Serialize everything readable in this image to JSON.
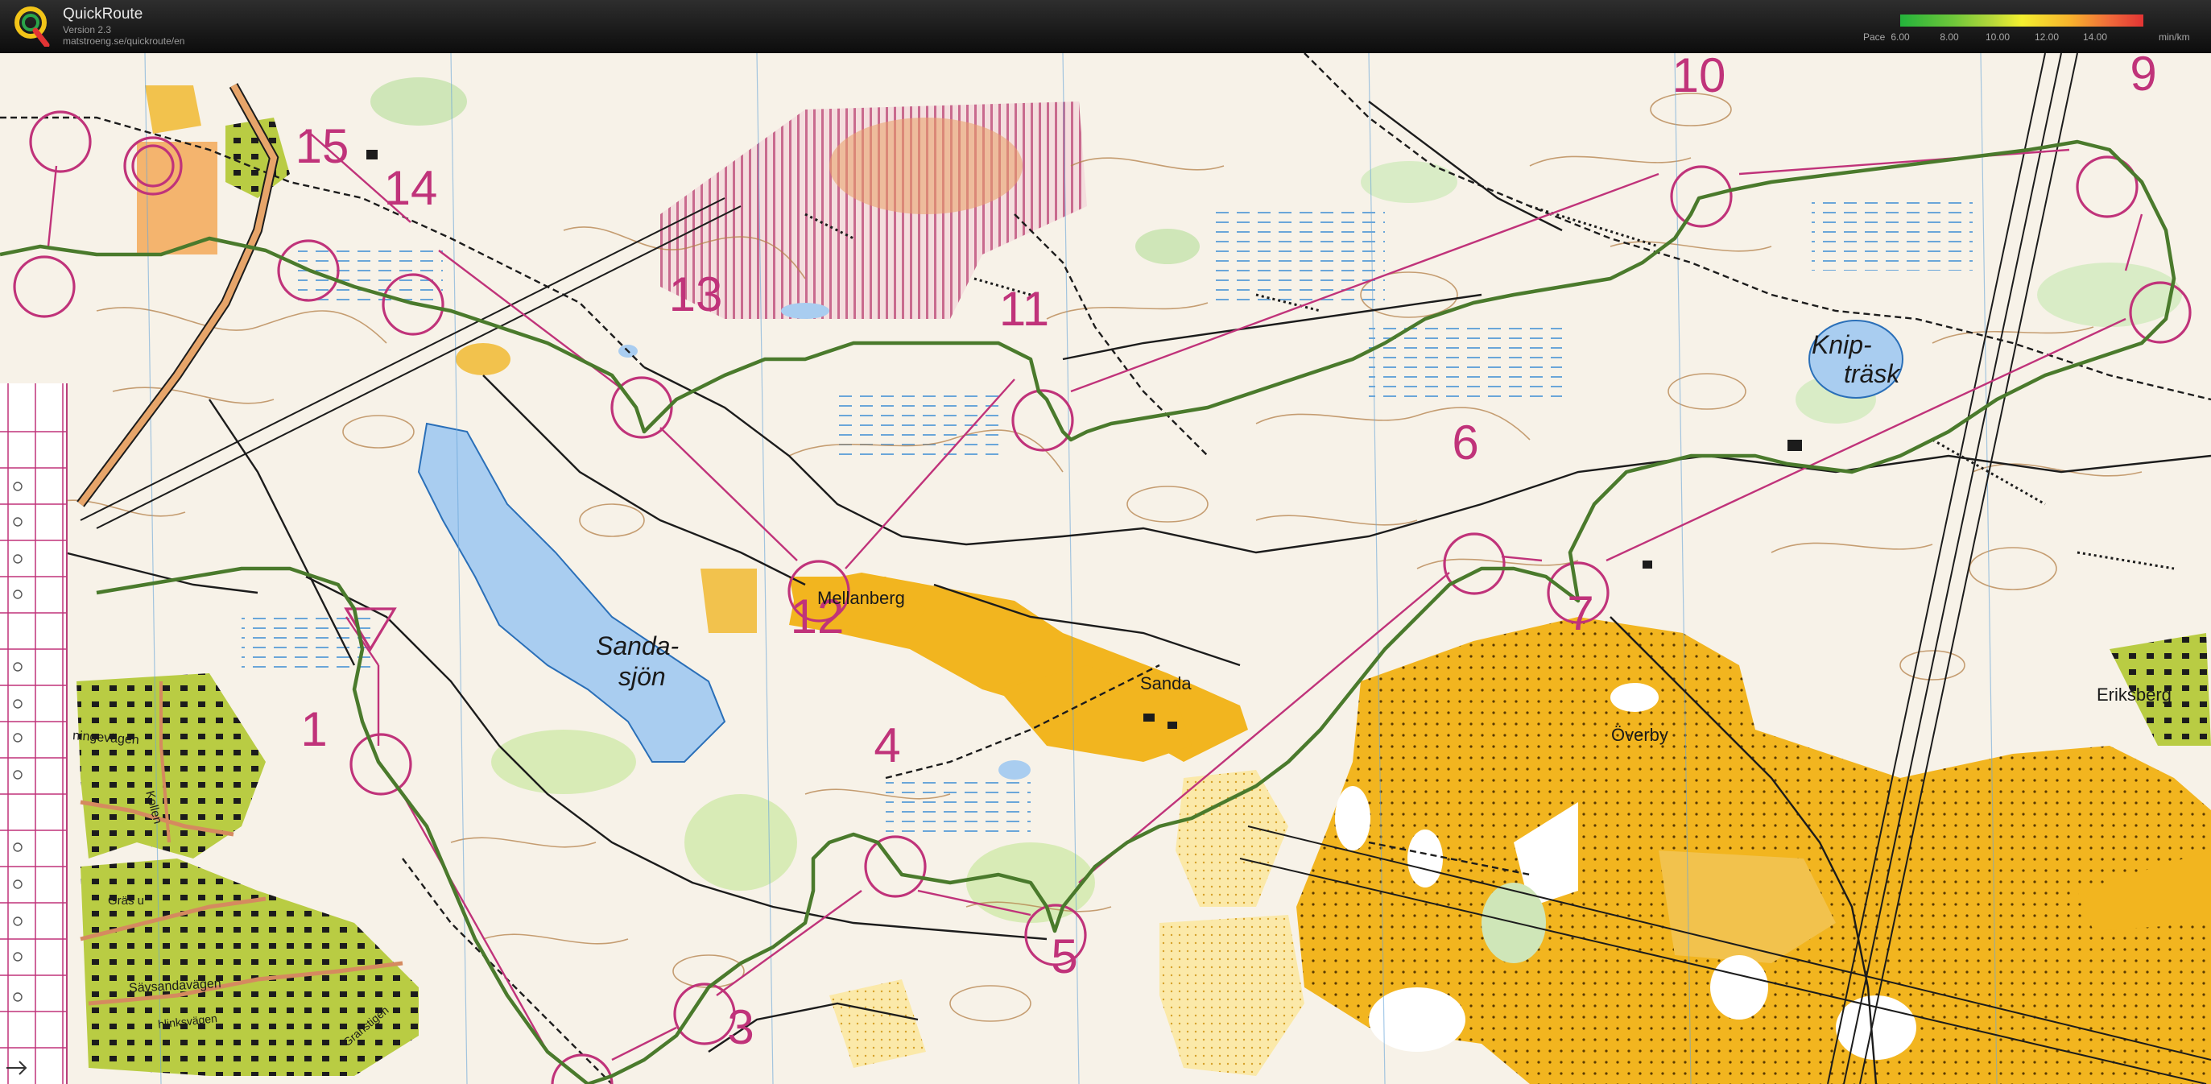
{
  "app": {
    "name": "QuickRoute",
    "version": "Version 2.3",
    "url": "matstroeng.se/quickroute/en"
  },
  "pace_legend": {
    "label": "Pace",
    "ticks": [
      "6.00",
      "8.00",
      "10.00",
      "12.00",
      "14.00"
    ],
    "unit": "min/km"
  },
  "map": {
    "place_names": {
      "mellanberg": "Mellanberg",
      "sanda": "Sanda",
      "overby": "Överby",
      "eriksberg": "Eriksberg",
      "sandasjon_1": "Sanda-",
      "sandasjon_2": "sjön",
      "kniptrask_1": "Knip-",
      "kniptrask_2": "träsk"
    },
    "road_labels": {
      "ningevagen": "ningevägen",
      "kollen": "Kollen",
      "grasu": "Gräs u",
      "savsandavagen": "Sävsandavägen",
      "hlinksvagen": "hlinksvägen",
      "granstigen": "Granstigen"
    },
    "controls": [
      {
        "number": "1"
      },
      {
        "number": "3"
      },
      {
        "number": "4"
      },
      {
        "number": "5"
      },
      {
        "number": "6"
      },
      {
        "number": "7"
      },
      {
        "number": "9"
      },
      {
        "number": "10"
      },
      {
        "number": "11"
      },
      {
        "number": "12"
      },
      {
        "number": "13"
      },
      {
        "number": "14"
      },
      {
        "number": "15"
      }
    ],
    "course_color": "#c0337a",
    "route_color": "#4a7a2c",
    "water_color": "#a9cdf0",
    "open_land_color": "#f2b51f",
    "forest_run_color": "#ffffff",
    "settlement_color": "#9fb83a"
  }
}
